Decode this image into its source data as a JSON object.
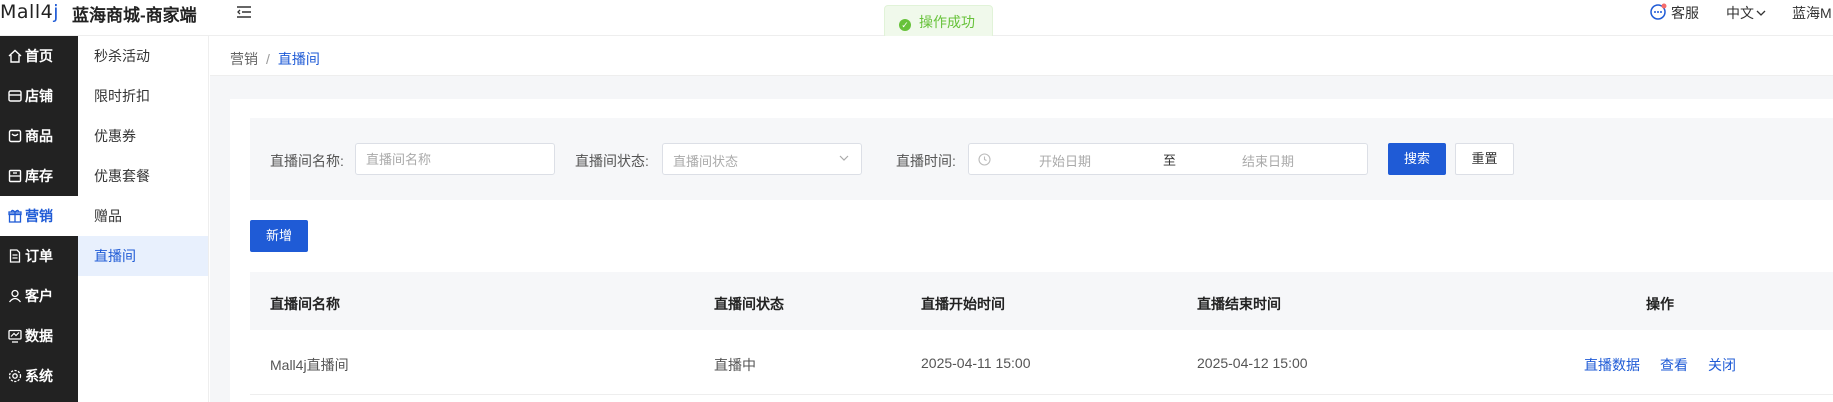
{
  "header": {
    "logo_part1": "Mall4",
    "logo_part2": "j",
    "app_title": "蓝海商城-商家端",
    "toast": "操作成功",
    "customer_service": "客服",
    "language": "中文",
    "user": "蓝海M"
  },
  "sidebar": {
    "items": [
      {
        "label": "首页",
        "icon": "home-icon"
      },
      {
        "label": "店铺",
        "icon": "store-icon"
      },
      {
        "label": "商品",
        "icon": "product-icon"
      },
      {
        "label": "库存",
        "icon": "inventory-icon"
      },
      {
        "label": "营销",
        "icon": "gift-icon"
      },
      {
        "label": "订单",
        "icon": "order-icon"
      },
      {
        "label": "客户",
        "icon": "customer-icon"
      },
      {
        "label": "数据",
        "icon": "data-icon"
      },
      {
        "label": "系统",
        "icon": "settings-icon"
      }
    ],
    "active_index": 4
  },
  "submenu": {
    "items": [
      "秒杀活动",
      "限时折扣",
      "优惠券",
      "优惠套餐",
      "赠品",
      "直播间"
    ],
    "active_index": 5
  },
  "breadcrumb": {
    "parent": "营销",
    "separator": "/",
    "current": "直播间"
  },
  "filter": {
    "name_label": "直播间名称:",
    "name_placeholder": "直播间名称",
    "status_label": "直播间状态:",
    "status_placeholder": "直播间状态",
    "time_label": "直播时间:",
    "start_placeholder": "开始日期",
    "range_separator": "至",
    "end_placeholder": "结束日期",
    "search_button": "搜索",
    "reset_button": "重置"
  },
  "add_button": "新增",
  "table": {
    "columns": [
      "直播间名称",
      "直播间状态",
      "直播开始时间",
      "直播结束时间",
      "操作"
    ],
    "rows": [
      {
        "name": "Mall4j直播间",
        "status": "直播中",
        "start": "2025-04-11 15:00",
        "end": "2025-04-12 15:00",
        "actions": [
          "直播数据",
          "查看",
          "关闭"
        ]
      }
    ]
  },
  "colors": {
    "primary": "#1f5bd6",
    "sidebar_bg": "#222222",
    "success": "#67c23a"
  }
}
